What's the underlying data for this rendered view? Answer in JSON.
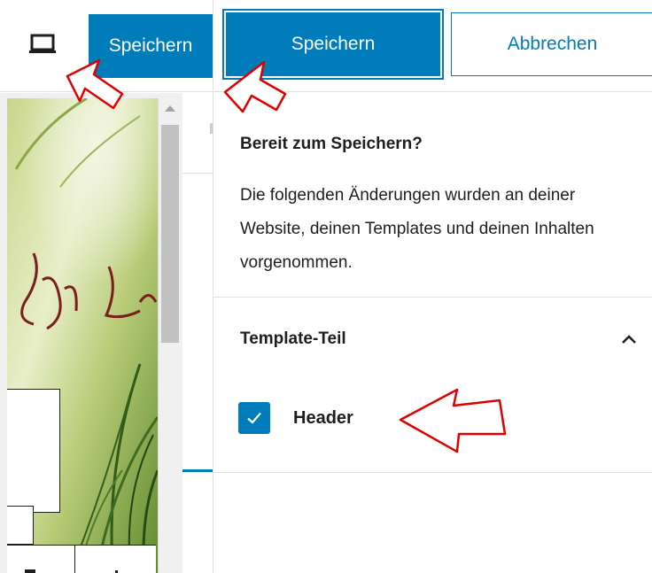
{
  "topbar": {
    "device_icon": "laptop-icon",
    "save_label": "Speichern"
  },
  "panel": {
    "save_label": "Speichern",
    "cancel_label": "Abbrechen",
    "summary_title": "Bereit zum Speichern?",
    "summary_description": "Die folgenden Änderungen wurden an deiner Website, deinen Templates und deinen Inhalten vorgenommen.",
    "section": {
      "title": "Template-Teil",
      "toggle_icon": "chevron-up-icon",
      "items": [
        {
          "label": "Header",
          "checked": true
        }
      ]
    }
  },
  "colors": {
    "accent": "#007cba",
    "annotation": "#e00000"
  },
  "annotations": [
    "red-arrow",
    "red-arrow",
    "red-arrow"
  ]
}
